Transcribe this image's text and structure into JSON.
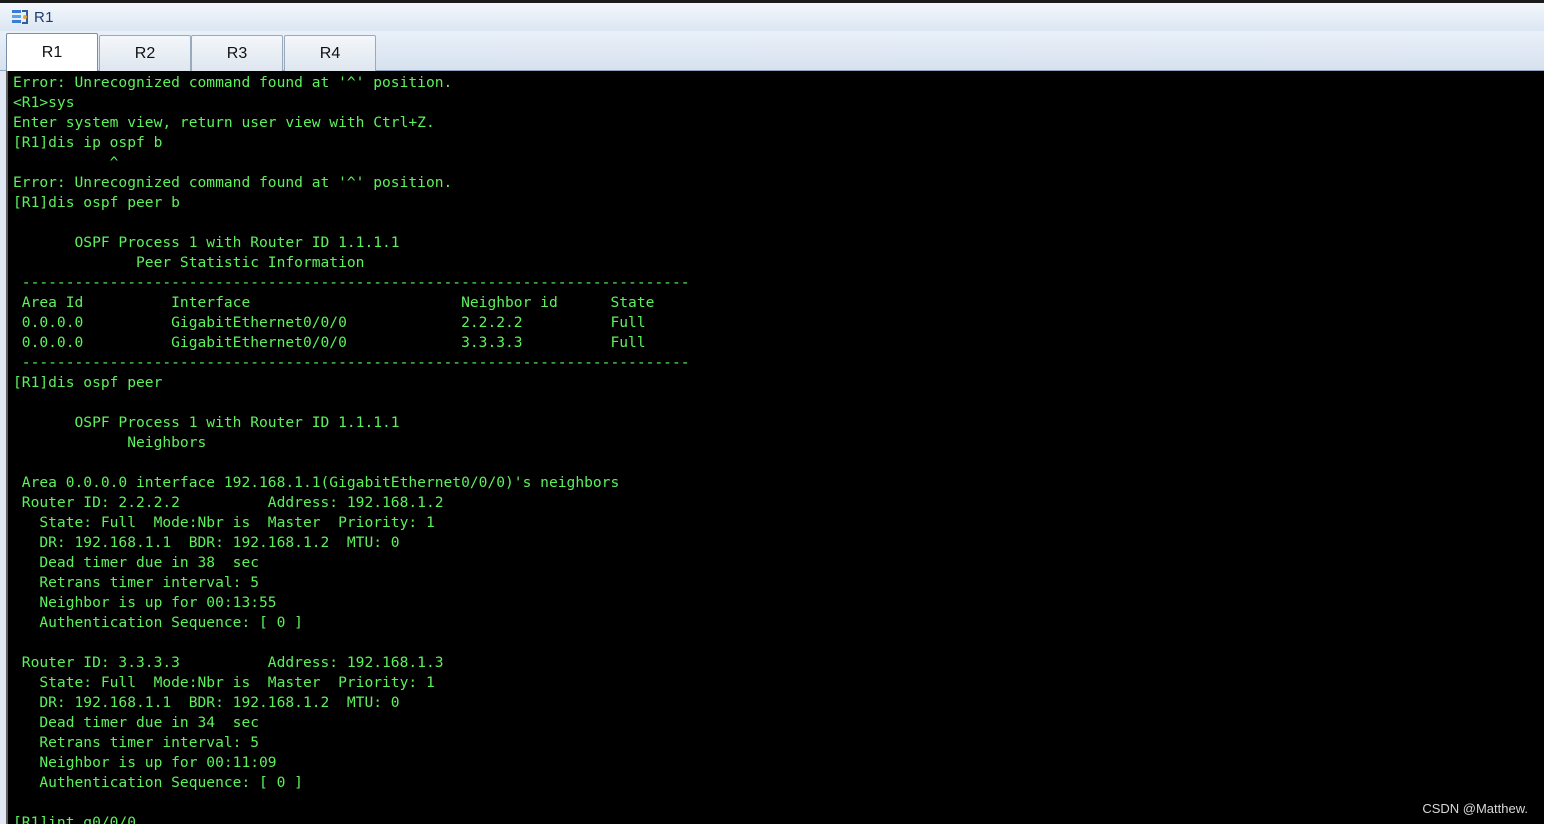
{
  "window": {
    "title": "R1",
    "icon": "router-app-icon"
  },
  "tabs": [
    {
      "label": "R1",
      "active": true
    },
    {
      "label": "R2",
      "active": false
    },
    {
      "label": "R3",
      "active": false
    },
    {
      "label": "R4",
      "active": false
    }
  ],
  "terminal": {
    "text_color": "#5cf25c",
    "background": "#000000",
    "lines": [
      "Error: Unrecognized command found at '^' position.",
      "<R1>sys",
      "Enter system view, return user view with Ctrl+Z.",
      "[R1]dis ip ospf b",
      "           ^",
      "Error: Unrecognized command found at '^' position.",
      "[R1]dis ospf peer b",
      "",
      "       OSPF Process 1 with Router ID 1.1.1.1",
      "              Peer Statistic Information",
      " ----------------------------------------------------------------------------",
      " Area Id          Interface                        Neighbor id      State",
      " 0.0.0.0          GigabitEthernet0/0/0             2.2.2.2          Full",
      " 0.0.0.0          GigabitEthernet0/0/0             3.3.3.3          Full",
      " ----------------------------------------------------------------------------",
      "[R1]dis ospf peer",
      "",
      "       OSPF Process 1 with Router ID 1.1.1.1",
      "             Neighbors",
      "",
      " Area 0.0.0.0 interface 192.168.1.1(GigabitEthernet0/0/0)'s neighbors",
      " Router ID: 2.2.2.2          Address: 192.168.1.2",
      "   State: Full  Mode:Nbr is  Master  Priority: 1",
      "   DR: 192.168.1.1  BDR: 192.168.1.2  MTU: 0",
      "   Dead timer due in 38  sec",
      "   Retrans timer interval: 5",
      "   Neighbor is up for 00:13:55",
      "   Authentication Sequence: [ 0 ]",
      "",
      " Router ID: 3.3.3.3          Address: 192.168.1.3",
      "   State: Full  Mode:Nbr is  Master  Priority: 1",
      "   DR: 192.168.1.1  BDR: 192.168.1.2  MTU: 0",
      "   Dead timer due in 34  sec",
      "   Retrans timer interval: 5",
      "   Neighbor is up for 00:11:09",
      "   Authentication Sequence: [ 0 ]",
      "",
      "[R1]int g0/0/0"
    ]
  },
  "watermark": "CSDN @Matthew."
}
